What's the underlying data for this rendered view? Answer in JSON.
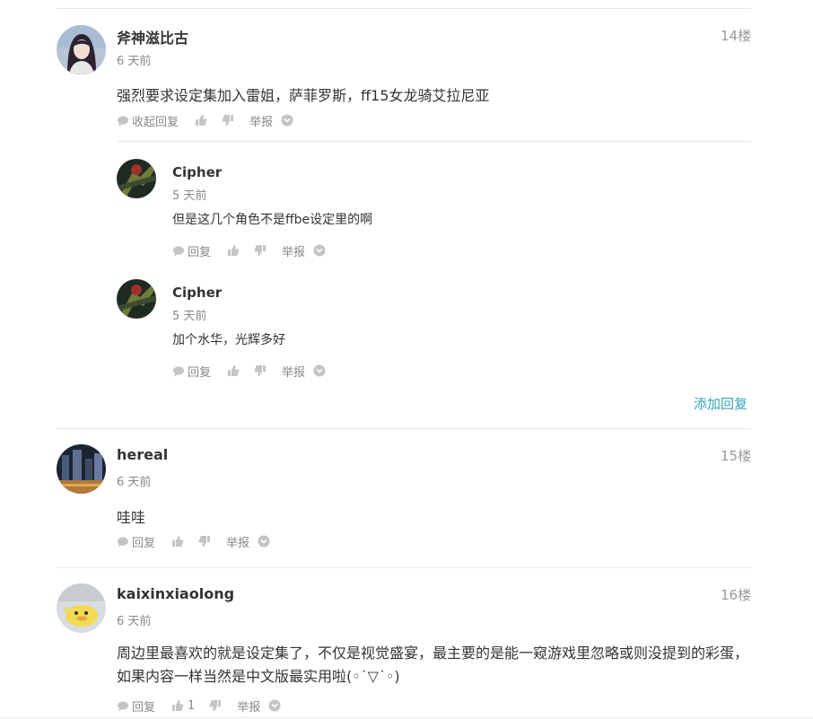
{
  "comments": [
    {
      "username": "斧神滋比古",
      "time": "6 天前",
      "floor": "14楼",
      "content": "强烈要求设定集加入雷姐，萨菲罗斯，ff15女龙骑艾拉尼亚",
      "reply_label": "收起回复",
      "like_count": "",
      "report_label": "举报",
      "replies": [
        {
          "username": "Cipher",
          "time": "5 天前",
          "content": "但是这几个角色不是ffbe设定里的啊",
          "reply_label": "回复",
          "report_label": "举报"
        },
        {
          "username": "Cipher",
          "time": "5 天前",
          "content": "加个水华，光辉多好",
          "reply_label": "回复",
          "report_label": "举报"
        }
      ],
      "add_reply_label": "添加回复"
    },
    {
      "username": "hereal",
      "time": "6 天前",
      "floor": "15楼",
      "content": "哇哇",
      "reply_label": "回复",
      "like_count": "",
      "report_label": "举报"
    },
    {
      "username": "kaixinxiaolong",
      "time": "6 天前",
      "floor": "16楼",
      "content": "周边里最喜欢的就是设定集了，不仅是视觉盛宴，最主要的是能一窥游戏里忽略或则没提到的彩蛋，如果内容一样当然是中文版最实用啦(◦˙▽˙◦)",
      "reply_label": "回复",
      "like_count": "1",
      "report_label": "举报"
    }
  ],
  "colors": {
    "link": "#36a3b7",
    "muted": "#888888",
    "divider": "#e8e8e8"
  },
  "icons": [
    "comment-icon",
    "thumbs-up-icon",
    "thumbs-down-icon",
    "chevron-down-icon"
  ]
}
